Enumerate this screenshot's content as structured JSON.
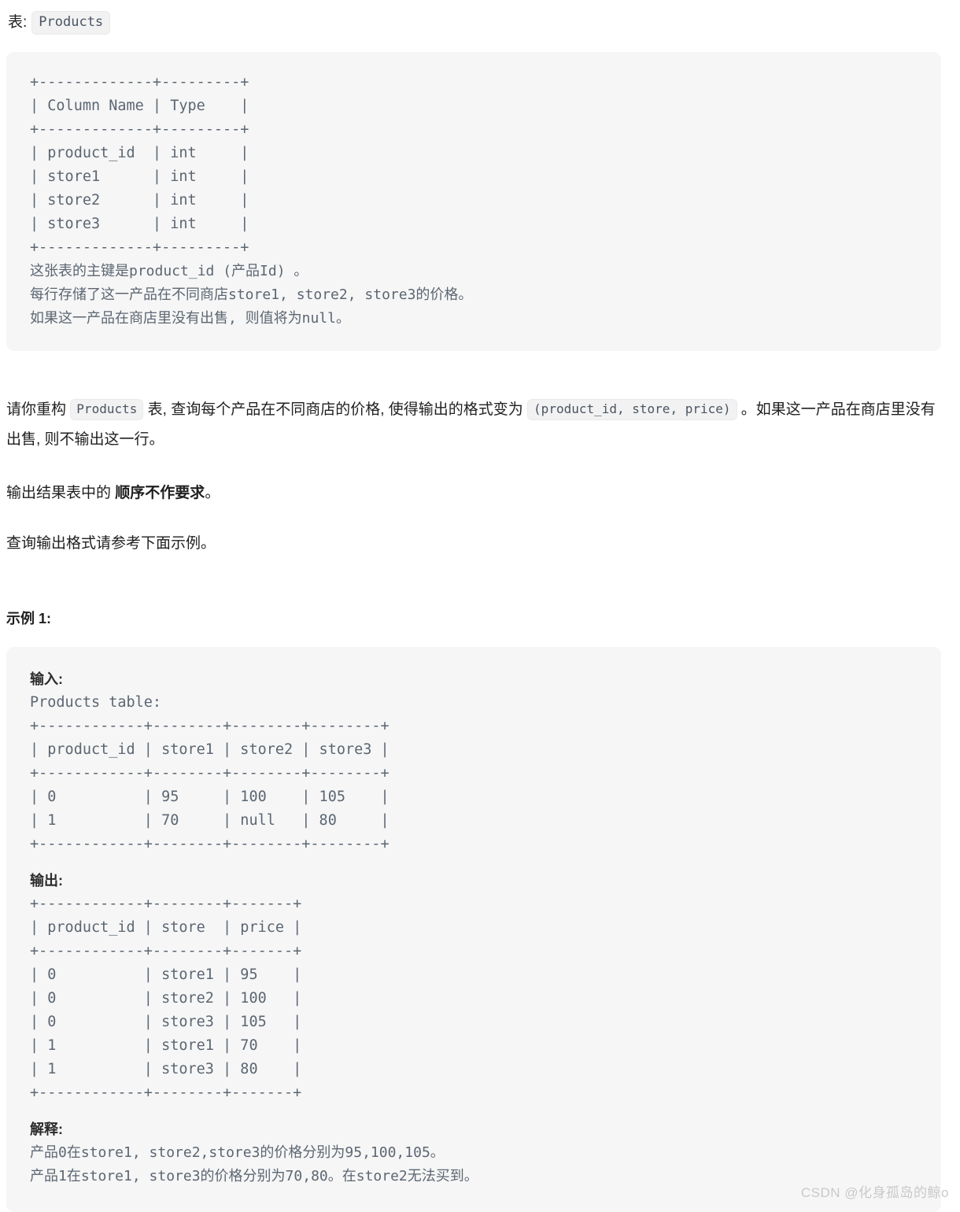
{
  "heading": {
    "label": "表:",
    "table_name": "Products"
  },
  "schema_panel": {
    "ascii_table": "+-------------+---------+\n| Column Name | Type    |\n+-------------+---------+\n| product_id  | int     |\n| store1      | int     |\n| store2      | int     |\n| store3      | int     |\n+-------------+---------+",
    "notes": "这张表的主键是product_id (产品Id) 。\n每行存储了这一产品在不同商店store1, store2, store3的价格。\n如果这一产品在商店里没有出售, 则值将为null。"
  },
  "description": {
    "para1_part1": "请你重构",
    "para1_code1": "Products",
    "para1_part2": "表, 查询每个产品在不同商店的价格, 使得输出的格式变为",
    "para1_code2": "(product_id, store, price)",
    "para1_part3": "。如果这一产品在商店里没有出售, 则不输出这一行。",
    "para2_part1": "输出结果表中的",
    "para2_bold": "顺序不作要求",
    "para2_part2": "。",
    "para3": "查询输出格式请参考下面示例。"
  },
  "example": {
    "title": "示例 1:",
    "input_label": "输入:",
    "input_caption": "Products table:",
    "input_table": "+------------+--------+--------+--------+\n| product_id | store1 | store2 | store3 |\n+------------+--------+--------+--------+\n| 0          | 95     | 100    | 105    |\n| 1          | 70     | null   | 80     |\n+------------+--------+--------+--------+",
    "output_label": "输出:",
    "output_table": "+------------+--------+-------+\n| product_id | store  | price |\n+------------+--------+-------+\n| 0          | store1 | 95    |\n| 0          | store2 | 100   |\n| 0          | store3 | 105   |\n| 1          | store1 | 70    |\n| 1          | store3 | 80    |\n+------------+--------+-------+",
    "explanation_label": "解释:",
    "explanation_text": "产品0在store1, store2,store3的价格分别为95,100,105。\n产品1在store1, store3的价格分别为70,80。在store2无法买到。"
  },
  "watermark": {
    "text": "CSDN @化身孤岛的鲸o"
  },
  "colors": {
    "panel_background": "#f6f6f6",
    "code_text": "#5c6672",
    "body_text": "#1f1f1f",
    "chip_background": "#f2f2f2",
    "watermark_text": "#c9c9c9"
  }
}
